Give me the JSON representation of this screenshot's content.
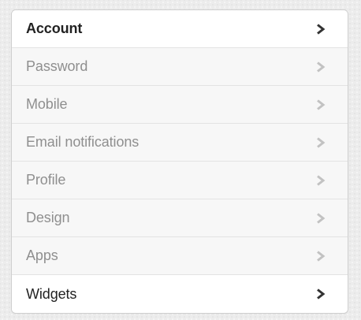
{
  "colors": {
    "active_text": "#222222",
    "inactive_text": "#8f8f8f",
    "active_chevron": "#333333",
    "inactive_chevron": "#c2c2c2"
  },
  "settings_menu": {
    "items": [
      {
        "label": "Account",
        "icon": "chevron-right-icon",
        "active": true
      },
      {
        "label": "Password",
        "icon": "chevron-right-icon",
        "active": false
      },
      {
        "label": "Mobile",
        "icon": "chevron-right-icon",
        "active": false
      },
      {
        "label": "Email notifications",
        "icon": "chevron-right-icon",
        "active": false
      },
      {
        "label": "Profile",
        "icon": "chevron-right-icon",
        "active": false
      },
      {
        "label": "Design",
        "icon": "chevron-right-icon",
        "active": false
      },
      {
        "label": "Apps",
        "icon": "chevron-right-icon",
        "active": false
      },
      {
        "label": "Widgets",
        "icon": "chevron-right-icon",
        "active": true
      }
    ]
  }
}
